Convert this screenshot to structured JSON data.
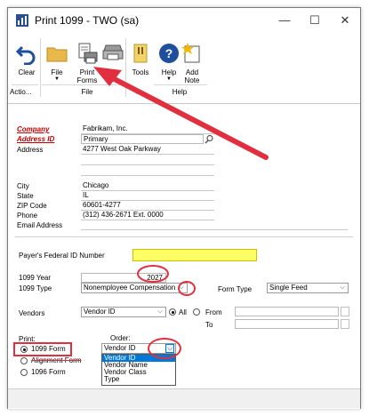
{
  "window": {
    "title": "Print 1099  -  TWO (sa)",
    "minimize": "—",
    "maximize": "☐",
    "close": "✕"
  },
  "ribbon": {
    "clear": "Clear",
    "file": "File",
    "print_forms_1": "Print",
    "print_forms_2": "Forms",
    "tools": "Tools",
    "help": "Help",
    "add_note_1": "Add",
    "add_note_2": "Note",
    "group_actions": "Actio...",
    "group_file": "File",
    "group_help": "Help"
  },
  "company": {
    "company_label": "Company",
    "company_value": "Fabrikam, Inc.",
    "address_id_label": "Address ID",
    "address_id_value": "Primary",
    "address_label": "Address",
    "address_line1": "4277 West Oak Parkway",
    "address_line2": "",
    "address_line3": "",
    "city_label": "City",
    "city_value": "Chicago",
    "state_label": "State",
    "state_value": "IL",
    "zip_label": "ZIP Code",
    "zip_value": "60601-4277",
    "phone_label": "Phone",
    "phone_value": "(312) 436-2671  Ext. 0000",
    "email_label": "Email Address",
    "email_value": ""
  },
  "payer": {
    "federal_id_label": "Payer's Federal ID Number",
    "federal_id_value": ""
  },
  "form": {
    "year_label": "1099 Year",
    "year_value": "2027",
    "type_label": "1099 Type",
    "type_value": "Nonemployee Compensation",
    "form_type_label": "Form Type",
    "form_type_value": "Single Feed"
  },
  "vendors": {
    "label": "Vendors",
    "selection": "Vendor ID",
    "all_label": "All",
    "from_label": "From",
    "to_label": "To",
    "from_value": "",
    "to_value": ""
  },
  "print": {
    "label": "Print:",
    "opt1": "1099 Form",
    "opt2": "Alignment Form",
    "opt3": "1096 Form",
    "order_label": "Order:",
    "order_value": "Vendor ID",
    "order_options": [
      "Vendor ID",
      "Vendor Name",
      "Vendor Class",
      "Type"
    ]
  },
  "colors": {
    "annotation": "#e03040",
    "highlight": "#0078d7",
    "required": "#c00000",
    "payer_field": "#ffff66"
  }
}
